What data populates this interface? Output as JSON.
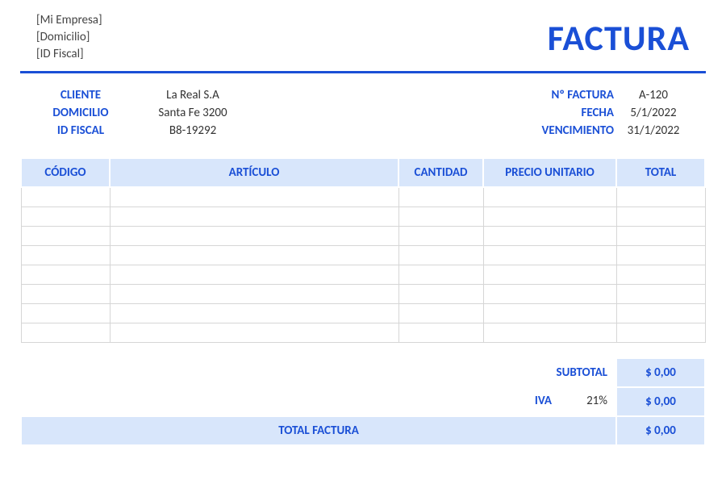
{
  "company": {
    "name": "[Mi Empresa]",
    "address": "[Domicilio]",
    "tax_id": "[ID Fiscal]"
  },
  "title": "FACTURA",
  "client": {
    "label_name": "CLIENTE",
    "label_address": "DOMICILIO",
    "label_tax": "ID FISCAL",
    "name": "La Real S.A",
    "address": "Santa Fe 3200",
    "tax_id": "B8-19292"
  },
  "invoice": {
    "label_number": "Nº FACTURA",
    "label_date": "FECHA",
    "label_due": "VENCIMIENTO",
    "number": "A-120",
    "date": "5/1/2022",
    "due": "31/1/2022"
  },
  "columns": {
    "code": "CÓDIGO",
    "article": "ARTÍCULO",
    "qty": "CANTIDAD",
    "unit_price": "PRECIO UNITARIO",
    "total": "TOTAL"
  },
  "totals": {
    "subtotal_label": "SUBTOTAL",
    "subtotal": "$ 0,00",
    "iva_label": "IVA",
    "iva_pct": "21%",
    "iva_amount": "$ 0,00",
    "grand_label": "TOTAL FACTURA",
    "grand_total": "$ 0,00"
  }
}
